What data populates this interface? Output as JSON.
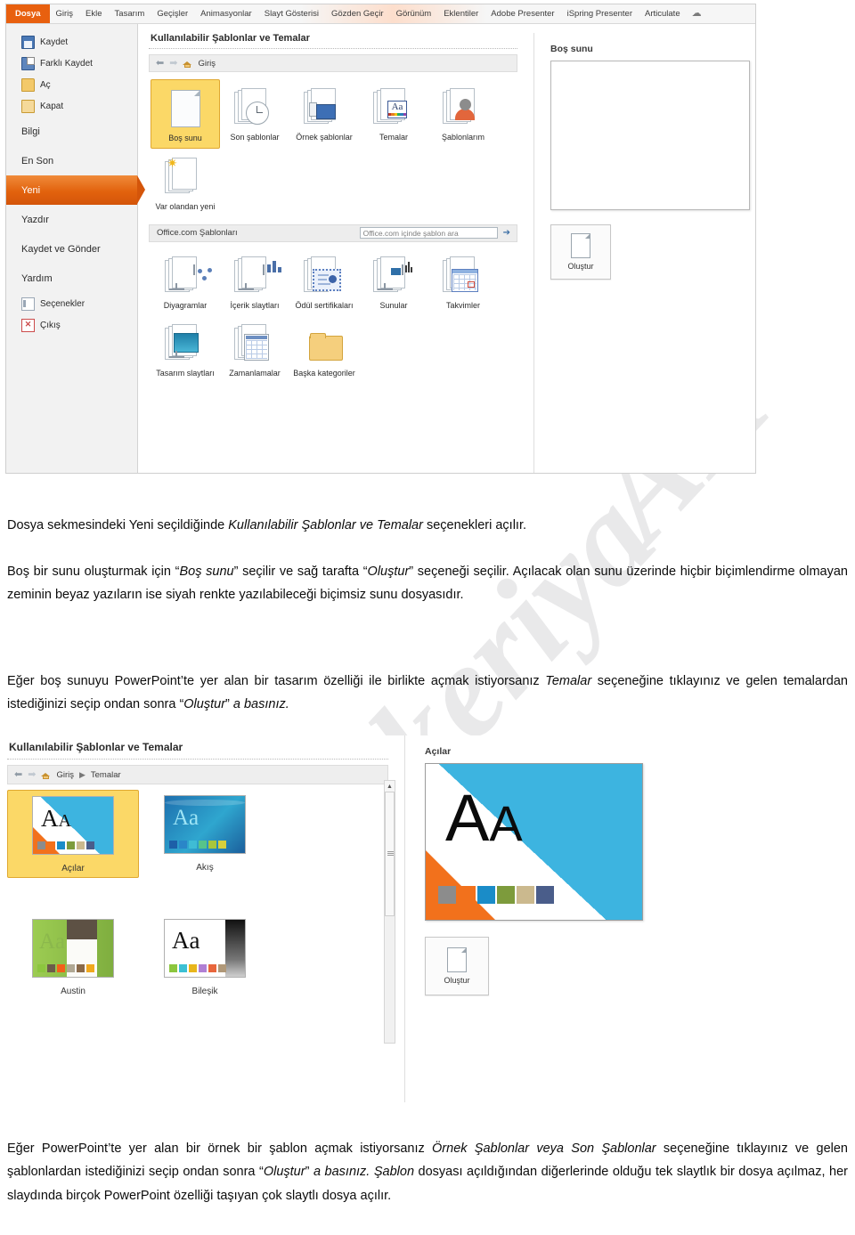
{
  "watermark": {
    "text1": "AK",
    "text2": "Zekeriya"
  },
  "screenshot1": {
    "ribbon": {
      "file_tab": "Dosya",
      "tabs": [
        "Giriş",
        "Ekle",
        "Tasarım",
        "Geçişler",
        "Animasyonlar",
        "Slayt Gösterisi",
        "Gözden Geçir",
        "Görünüm",
        "Eklentiler",
        "Adobe Presenter",
        "iSpring Presenter",
        "Articulate"
      ],
      "help_icon": "help-icon"
    },
    "backstage_nav": [
      {
        "label": "Kaydet",
        "icon": "save-icon",
        "selected": false
      },
      {
        "label": "Farklı Kaydet",
        "icon": "save-as-icon",
        "selected": false
      },
      {
        "label": "Aç",
        "icon": "open-folder-icon",
        "selected": false
      },
      {
        "label": "Kapat",
        "icon": "close-folder-icon",
        "selected": false
      },
      {
        "label": "Bilgi",
        "icon": "",
        "selected": false
      },
      {
        "label": "En Son",
        "icon": "",
        "selected": false
      },
      {
        "label": "Yeni",
        "icon": "",
        "selected": true
      },
      {
        "label": "Yazdır",
        "icon": "",
        "selected": false
      },
      {
        "label": "Kaydet ve Gönder",
        "icon": "",
        "selected": false
      },
      {
        "label": "Yardım",
        "icon": "",
        "selected": false
      },
      {
        "label": "Seçenekler",
        "icon": "options-icon",
        "selected": false
      },
      {
        "label": "Çıkış",
        "icon": "exit-icon",
        "selected": false
      }
    ],
    "panel_title": "Kullanılabilir Şablonlar ve Temalar",
    "breadcrumb": {
      "home": "Giriş",
      "back_icon": "back-arrow-icon",
      "forward_icon": "forward-arrow-icon",
      "home_icon": "home-icon"
    },
    "tiles": [
      {
        "label": "Boş sunu",
        "icon": "blank-page-icon",
        "selected": true
      },
      {
        "label": "Son şablonlar",
        "icon": "clock-templates-icon",
        "selected": false
      },
      {
        "label": "Örnek şablonlar",
        "icon": "sample-templates-icon",
        "selected": false
      },
      {
        "label": "Temalar",
        "icon": "themes-icon",
        "selected": false
      },
      {
        "label": "Şablonlarım",
        "icon": "my-templates-icon",
        "selected": false
      },
      {
        "label": "Var olandan yeni",
        "icon": "new-from-existing-icon",
        "selected": false
      }
    ],
    "office_section": {
      "title": "Office.com Şablonları",
      "search_placeholder": "Office.com içinde şablon ara",
      "go_icon": "arrow-right-icon",
      "categories": [
        {
          "label": "Diyagramlar",
          "icon": "diagram-slide-icon"
        },
        {
          "label": "İçerik slaytları",
          "icon": "content-slide-icon"
        },
        {
          "label": "Ödül sertifikaları",
          "icon": "award-certificate-icon"
        },
        {
          "label": "Sunular",
          "icon": "presentations-icon"
        },
        {
          "label": "Takvimler",
          "icon": "calendar-icon"
        },
        {
          "label": "Tasarım slaytları",
          "icon": "design-slide-icon"
        },
        {
          "label": "Zamanlamalar",
          "icon": "schedules-icon"
        },
        {
          "label": "Başka kategoriler",
          "icon": "folder-icon"
        }
      ]
    },
    "preview": {
      "title": "Boş sunu",
      "create_label": "Oluştur",
      "create_icon": "new-document-icon"
    }
  },
  "screenshot2": {
    "panel_title": "Kullanılabilir Şablonlar ve Temalar",
    "breadcrumb": {
      "home": "Giriş",
      "current": "Temalar",
      "separator": "▶",
      "back_icon": "back-arrow-icon",
      "forward_icon": "forward-arrow-icon",
      "home_icon": "home-icon"
    },
    "themes": [
      {
        "name": "Açılar",
        "selected": true,
        "letters": "Aa",
        "swatches": [
          "#8c8c8c",
          "#f2711c",
          "#1a8cc8",
          "#7d9b3c",
          "#cbb98e",
          "#4a5d8a"
        ]
      },
      {
        "name": "Akış",
        "selected": false,
        "letters": "Aa",
        "swatches": [
          "#1d5fa8",
          "#2a86c8",
          "#3fbcd4",
          "#57c48a",
          "#a9c63c",
          "#d6cf3c"
        ]
      },
      {
        "name": "Austin",
        "selected": false,
        "letters": "Aa",
        "swatches": [
          "#8cc63e",
          "#6b5c4a",
          "#f2601a",
          "#b0a894",
          "#8a6a4a",
          "#f0a81e"
        ]
      },
      {
        "name": "Bileşik",
        "selected": false,
        "letters": "Aa",
        "swatches": [
          "#8cc63e",
          "#3cc0d4",
          "#e8b61c",
          "#b07fd4",
          "#e8663c",
          "#b09878"
        ]
      }
    ],
    "scrollbar": {
      "up_icon": "scroll-up-icon"
    },
    "preview": {
      "title": "Açılar",
      "create_label": "Oluştur",
      "create_icon": "new-document-icon"
    }
  },
  "paragraphs": {
    "p1_a": "Dosya sekmesindeki Yeni seçildiğinde ",
    "p1_i": "Kullanılabilir Şablonlar ve Temalar",
    "p1_b": " seçenekleri açılır.",
    "p2_a": "Boş bir sunu oluşturmak için  “",
    "p2_i1": "Boş sunu",
    "p2_b": "” seçilir ve sağ tarafta “",
    "p2_i2": "Oluştur",
    "p2_c": "” seçeneği seçilir. Açılacak olan sunu üzerinde hiçbir biçimlendirme olmayan zeminin beyaz yazıların ise siyah renkte yazılabileceği biçimsiz sunu dosyasıdır.",
    "p3_a": "Eğer boş sunuyu PowerPoint’te yer alan bir tasarım özelliği ile birlikte açmak istiyorsanız ",
    "p3_i1": "Temalar",
    "p3_b": " seçeneğine tıklayınız ve gelen temalardan istediğinizi seçip ondan sonra “",
    "p3_i2": "Oluştur",
    "p3_c": "” ",
    "p3_i3": "a basınız.",
    "p4_a": "Eğer PowerPoint’te yer alan bir örnek bir şablon açmak istiyorsanız ",
    "p4_i1": "Örnek Şablonlar veya Son Şablonlar",
    "p4_b": " seçeneğine tıklayınız ve gelen şablonlardan istediğinizi seçip ondan sonra “",
    "p4_i2": "Oluştur",
    "p4_c": "” ",
    "p4_i3": "a basınız. Şablon",
    "p4_d": " dosyası açıldığından diğerlerinde olduğu tek slaytlık bir dosya açılmaz, her slaydında birçok PowerPoint özelliği taşıyan çok slaytlı dosya açılır."
  }
}
